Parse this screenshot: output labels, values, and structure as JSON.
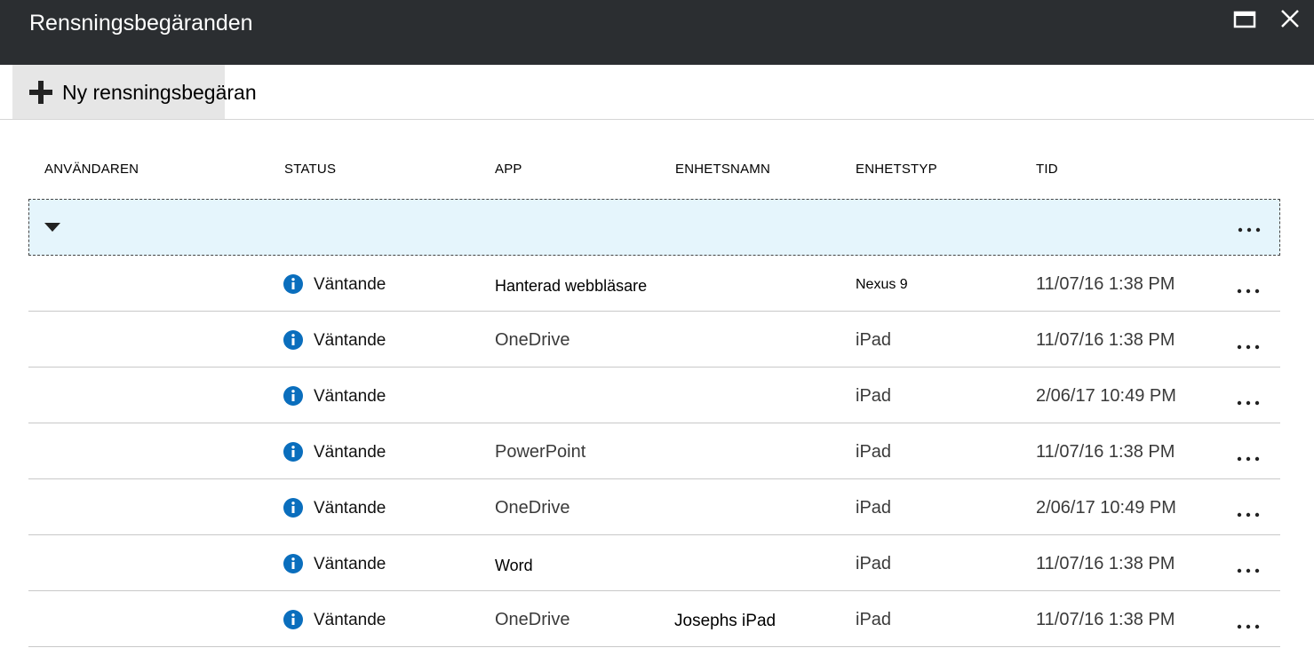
{
  "window": {
    "title": "Rensningsbegäranden",
    "maximize_icon": "maximize-icon",
    "close_icon": "close-icon"
  },
  "toolbar": {
    "new_request_label": "Ny rensningsbegäran",
    "new_request_icon": "plus-icon"
  },
  "table": {
    "columns": [
      "ANVÄNDAREN",
      "STATUS",
      "APP",
      "ENHETSNAMN",
      "ENHETSTYP",
      "TID"
    ],
    "group_row": {
      "expand_icon": "caret-down-icon",
      "more_icon": "more-icon"
    },
    "rows": [
      {
        "user": "",
        "status": "Väntande",
        "app": "Hanterad webbläsare",
        "device_name": "",
        "device_type": "Nexus 9",
        "time": "11/07/16 1:38 PM"
      },
      {
        "user": "",
        "status": "Väntande",
        "app": "OneDrive",
        "device_name": "",
        "device_type": "iPad",
        "time": "11/07/16 1:38 PM"
      },
      {
        "user": "",
        "status": "Väntande",
        "app": "",
        "device_name": "",
        "device_type": "iPad",
        "time": "2/06/17 10:49 PM"
      },
      {
        "user": "",
        "status": "Väntande",
        "app": "PowerPoint",
        "device_name": "",
        "device_type": "iPad",
        "time": "11/07/16 1:38 PM"
      },
      {
        "user": "",
        "status": "Väntande",
        "app": "OneDrive",
        "device_name": "",
        "device_type": "iPad",
        "time": "2/06/17 10:49 PM"
      },
      {
        "user": "",
        "status": "Väntande",
        "app": "Word",
        "device_name": "",
        "device_type": "iPad",
        "time": "11/07/16 1:38 PM"
      },
      {
        "user": "",
        "status": "Väntande",
        "app": "OneDrive",
        "device_name": "Josephs iPad",
        "device_type": "iPad",
        "time": "11/07/16 1:38 PM"
      }
    ]
  },
  "colors": {
    "titlebar": "#2b2e31",
    "accent_info": "#0a6ebd",
    "group_row_bg": "#e5f5fc",
    "toolbar_button_bg": "#e6e6e6"
  }
}
